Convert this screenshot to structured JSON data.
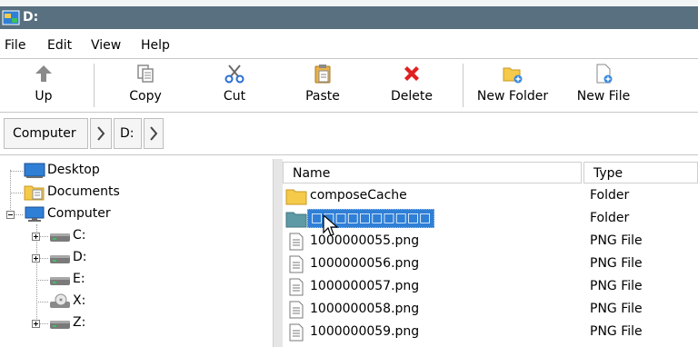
{
  "window": {
    "title": "D:"
  },
  "menu": [
    "File",
    "Edit",
    "View",
    "Help"
  ],
  "toolbar": {
    "up": "Up",
    "copy": "Copy",
    "cut": "Cut",
    "paste": "Paste",
    "delete": "Delete",
    "new_folder": "New Folder",
    "new_file": "New File"
  },
  "breadcrumb": {
    "root": "Computer",
    "drive": "D:"
  },
  "tree": {
    "desktop": "Desktop",
    "documents": "Documents",
    "computer": "Computer",
    "drives": [
      "C:",
      "D:",
      "E:",
      "X:",
      "Z:"
    ]
  },
  "list": {
    "columns": {
      "name": "Name",
      "type": "Type"
    },
    "rows": [
      {
        "name": "composeCache",
        "type": "Folder",
        "icon": "folder-icon",
        "selected": false
      },
      {
        "name": "□□□□□□□□□□",
        "type": "Folder",
        "icon": "folder-icon",
        "selected": true
      },
      {
        "name": "1000000055.png",
        "type": "PNG File",
        "icon": "file-icon",
        "selected": false
      },
      {
        "name": "1000000056.png",
        "type": "PNG File",
        "icon": "file-icon",
        "selected": false
      },
      {
        "name": "1000000057.png",
        "type": "PNG File",
        "icon": "file-icon",
        "selected": false
      },
      {
        "name": "1000000058.png",
        "type": "PNG File",
        "icon": "file-icon",
        "selected": false
      },
      {
        "name": "1000000059.png",
        "type": "PNG File",
        "icon": "file-icon",
        "selected": false
      }
    ]
  },
  "colors": {
    "titlebar": "#58707f",
    "selection": "#2f7fd6",
    "delete_red": "#e02020",
    "folder_yellow": "#f5c94a",
    "cut_blue": "#2a6fd0"
  }
}
